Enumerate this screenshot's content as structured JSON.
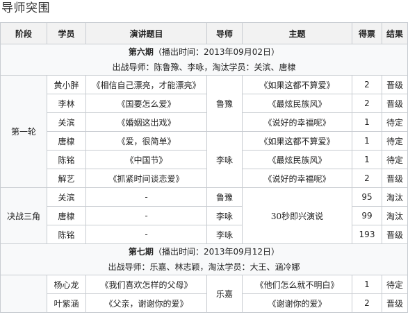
{
  "page": {
    "title": "导师突围"
  },
  "table": {
    "headers": [
      "阶段",
      "学员",
      "演讲题目",
      "导师",
      "主题",
      "得票",
      "结果"
    ],
    "period6": {
      "title_prefix": "第六期",
      "air_label": "（播出时间：",
      "air_date": "2013年09月02日",
      "air_close": "）",
      "info": "出战导师：陈鲁豫、李咏，淘汰学员：关滨、唐棣"
    },
    "round1": {
      "stage": "第一轮",
      "rows": [
        {
          "student": "黄小胖",
          "speech": "《相信自己漂亮，才能漂亮》",
          "theme": "《如果这都不算爱》",
          "votes": "2",
          "result": "晋级"
        },
        {
          "student": "李林",
          "speech": "《国要怎么爱》",
          "theme": "《最炫民族风》",
          "votes": "2",
          "result": "晋级"
        },
        {
          "student": "关滨",
          "speech": "《婚姻这出戏》",
          "theme": "《说好的幸福呢》",
          "votes": "1",
          "result": "待定"
        },
        {
          "student": "唐棣",
          "speech": "《爱，很简单》",
          "theme": "《如果这都不算爱》",
          "votes": "1",
          "result": "待定"
        },
        {
          "student": "陈铭",
          "speech": "《中国节》",
          "theme": "《最炫民族风》",
          "votes": "1",
          "result": "待定"
        },
        {
          "student": "解艺",
          "speech": "《抓紧时间谈恋爱》",
          "theme": "《说好的幸福呢》",
          "votes": "2",
          "result": "晋级"
        }
      ],
      "mentor_a": "鲁豫",
      "mentor_b": "李咏"
    },
    "final": {
      "stage": "决战三角",
      "theme": "30秒即兴演说",
      "rows": [
        {
          "student": "关滨",
          "speech": "-",
          "mentor": "鲁豫",
          "votes": "95",
          "result": "淘汰"
        },
        {
          "student": "唐棣",
          "speech": "-",
          "mentor": "李咏",
          "votes": "99",
          "result": "淘汰"
        },
        {
          "student": "陈铭",
          "speech": "-",
          "mentor": "李咏",
          "votes": "193",
          "result": "晋级"
        }
      ]
    },
    "period7": {
      "title_prefix": "第七期",
      "air_label": "（播出时间：",
      "air_date": "2013年09月12日",
      "air_close": "）",
      "info": "出战导师：乐嘉、林志颖，淘汰学员：大王、涵冷娜"
    },
    "round1_p7": {
      "mentor": "乐嘉",
      "rows": [
        {
          "student": "杨心龙",
          "speech": "《我们喜欢怎样的父母》",
          "theme": "《他们怎么就不明白》",
          "votes": "1",
          "result": "待定"
        },
        {
          "student": "叶紫涵",
          "speech": "《父亲，谢谢你的爱》",
          "theme": "《谢谢你的爱》",
          "votes": "2",
          "result": "晋级"
        }
      ]
    }
  }
}
